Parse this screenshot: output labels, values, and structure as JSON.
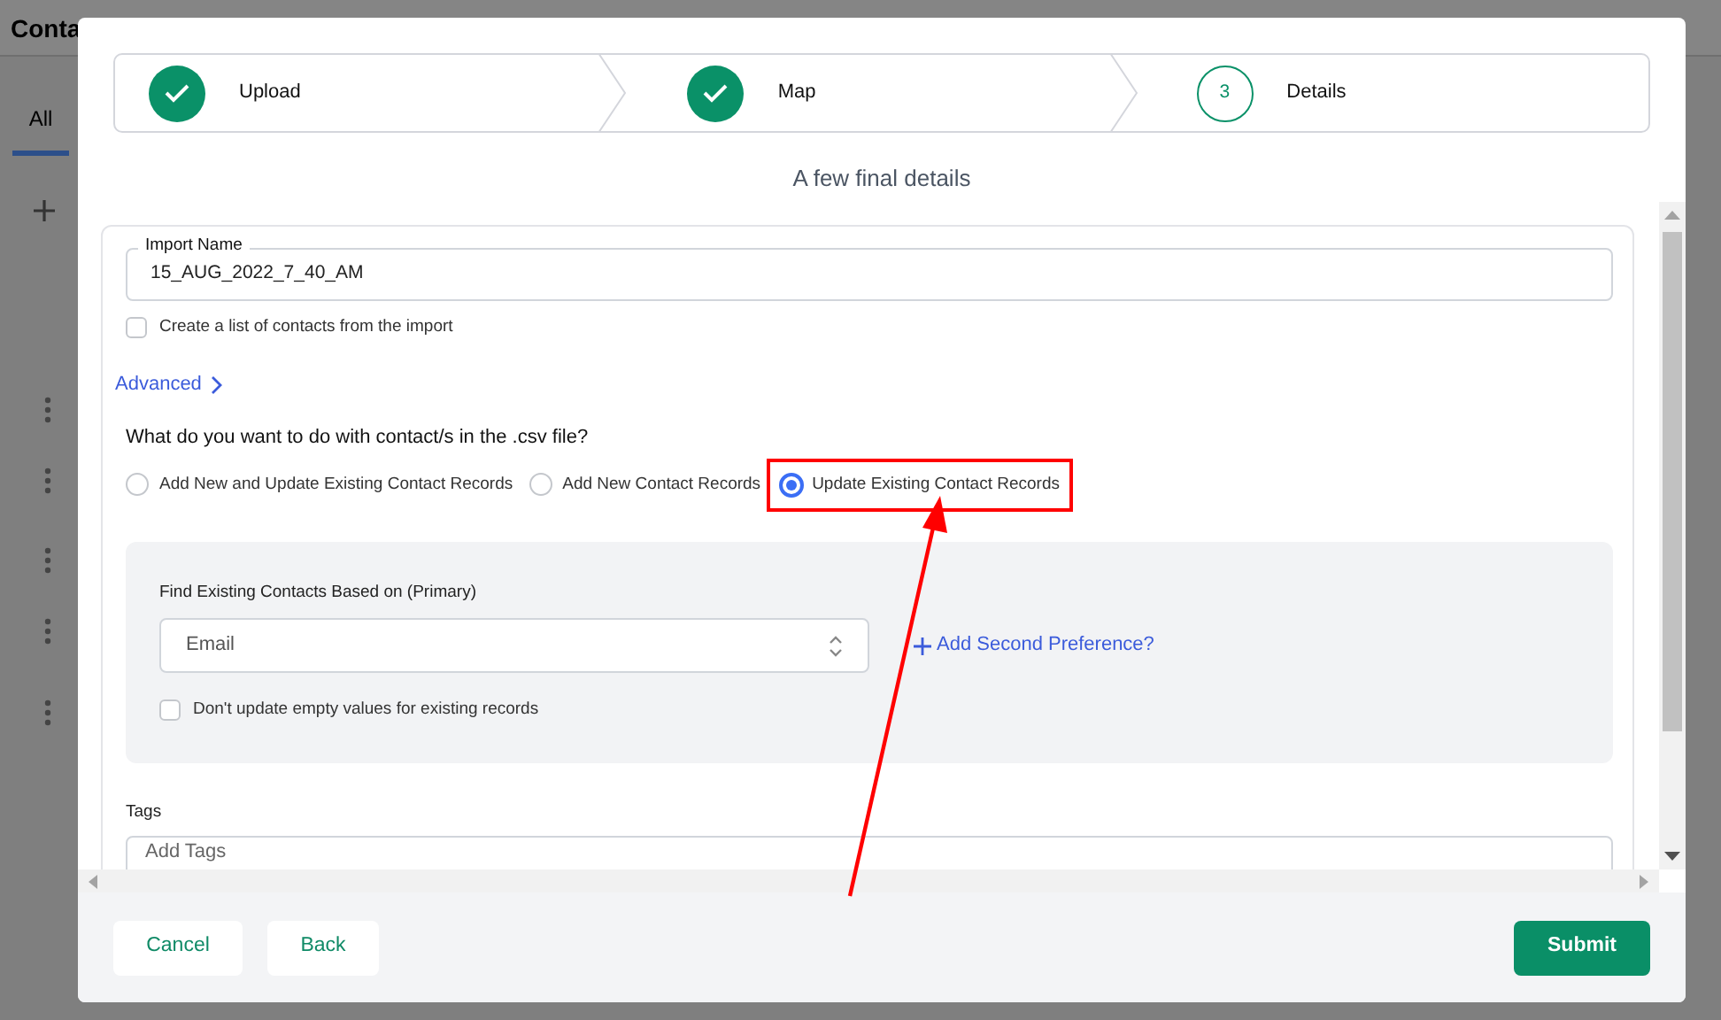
{
  "background": {
    "title": "Conta",
    "tab": "All"
  },
  "steps": [
    {
      "label": "Upload",
      "done": true
    },
    {
      "label": "Map",
      "done": true
    },
    {
      "number": "3",
      "label": "Details",
      "done": false
    }
  ],
  "subtitle": "A few final details",
  "import_name": {
    "label": "Import Name",
    "value": "15_AUG_2022_7_40_AM"
  },
  "create_list": {
    "label": "Create a list of contacts from the import",
    "checked": false
  },
  "advanced": "Advanced",
  "question": "What do you want to do with contact/s in the .csv file?",
  "options": [
    {
      "label": "Add New and Update Existing Contact Records",
      "selected": false,
      "highlighted": false
    },
    {
      "label": "Add New Contact Records",
      "selected": false,
      "highlighted": false
    },
    {
      "label": "Update Existing Contact Records",
      "selected": true,
      "highlighted": true
    }
  ],
  "match": {
    "label": "Find Existing Contacts Based on (Primary)",
    "value": "Email",
    "add_second": "Add Second Preference?",
    "skip_empty": {
      "label": "Don't update empty values for existing records",
      "checked": false
    }
  },
  "tags": {
    "label": "Tags",
    "placeholder": "Add Tags"
  },
  "buttons": {
    "cancel": "Cancel",
    "back": "Back",
    "submit": "Submit"
  }
}
